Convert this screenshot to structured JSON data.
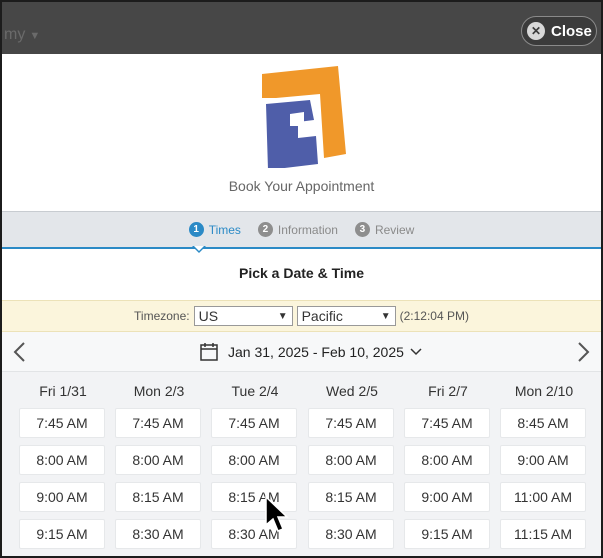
{
  "topbar": {
    "menu_text": "my",
    "close_label": "Close"
  },
  "header": {
    "title": "Book Your Appointment"
  },
  "steps": [
    {
      "num": "1",
      "label": "Times",
      "active": true
    },
    {
      "num": "2",
      "label": "Information",
      "active": false
    },
    {
      "num": "3",
      "label": "Review",
      "active": false
    }
  ],
  "pick_title": "Pick a Date & Time",
  "timezone": {
    "label": "Timezone:",
    "region": "US",
    "zone": "Pacific",
    "clock": "(2:12:04 PM)"
  },
  "date_range": "Jan 31, 2025 - Feb 10, 2025",
  "days": [
    {
      "label": "Fri 1/31",
      "slots": [
        "7:45 AM",
        "8:00 AM",
        "9:00 AM",
        "9:15 AM"
      ]
    },
    {
      "label": "Mon 2/3",
      "slots": [
        "7:45 AM",
        "8:00 AM",
        "8:15 AM",
        "8:30 AM"
      ]
    },
    {
      "label": "Tue 2/4",
      "slots": [
        "7:45 AM",
        "8:00 AM",
        "8:15 AM",
        "8:30 AM"
      ]
    },
    {
      "label": "Wed 2/5",
      "slots": [
        "7:45 AM",
        "8:00 AM",
        "8:15 AM",
        "8:30 AM"
      ]
    },
    {
      "label": "Fri 2/7",
      "slots": [
        "7:45 AM",
        "8:00 AM",
        "9:00 AM",
        "9:15 AM"
      ]
    },
    {
      "label": "Mon 2/10",
      "slots": [
        "8:45 AM",
        "9:00 AM",
        "11:00 AM",
        "11:15 AM"
      ]
    }
  ],
  "colors": {
    "accent": "#2b8ac6",
    "logo_orange": "#f0982a",
    "logo_blue": "#4f5ea9",
    "timezone_bg": "#fbf5dc"
  },
  "icons": {
    "close": "close-icon",
    "prev": "chevron-left-icon",
    "next": "chevron-right-icon",
    "calendar": "calendar-icon",
    "cursor": "mouse-pointer-icon"
  }
}
